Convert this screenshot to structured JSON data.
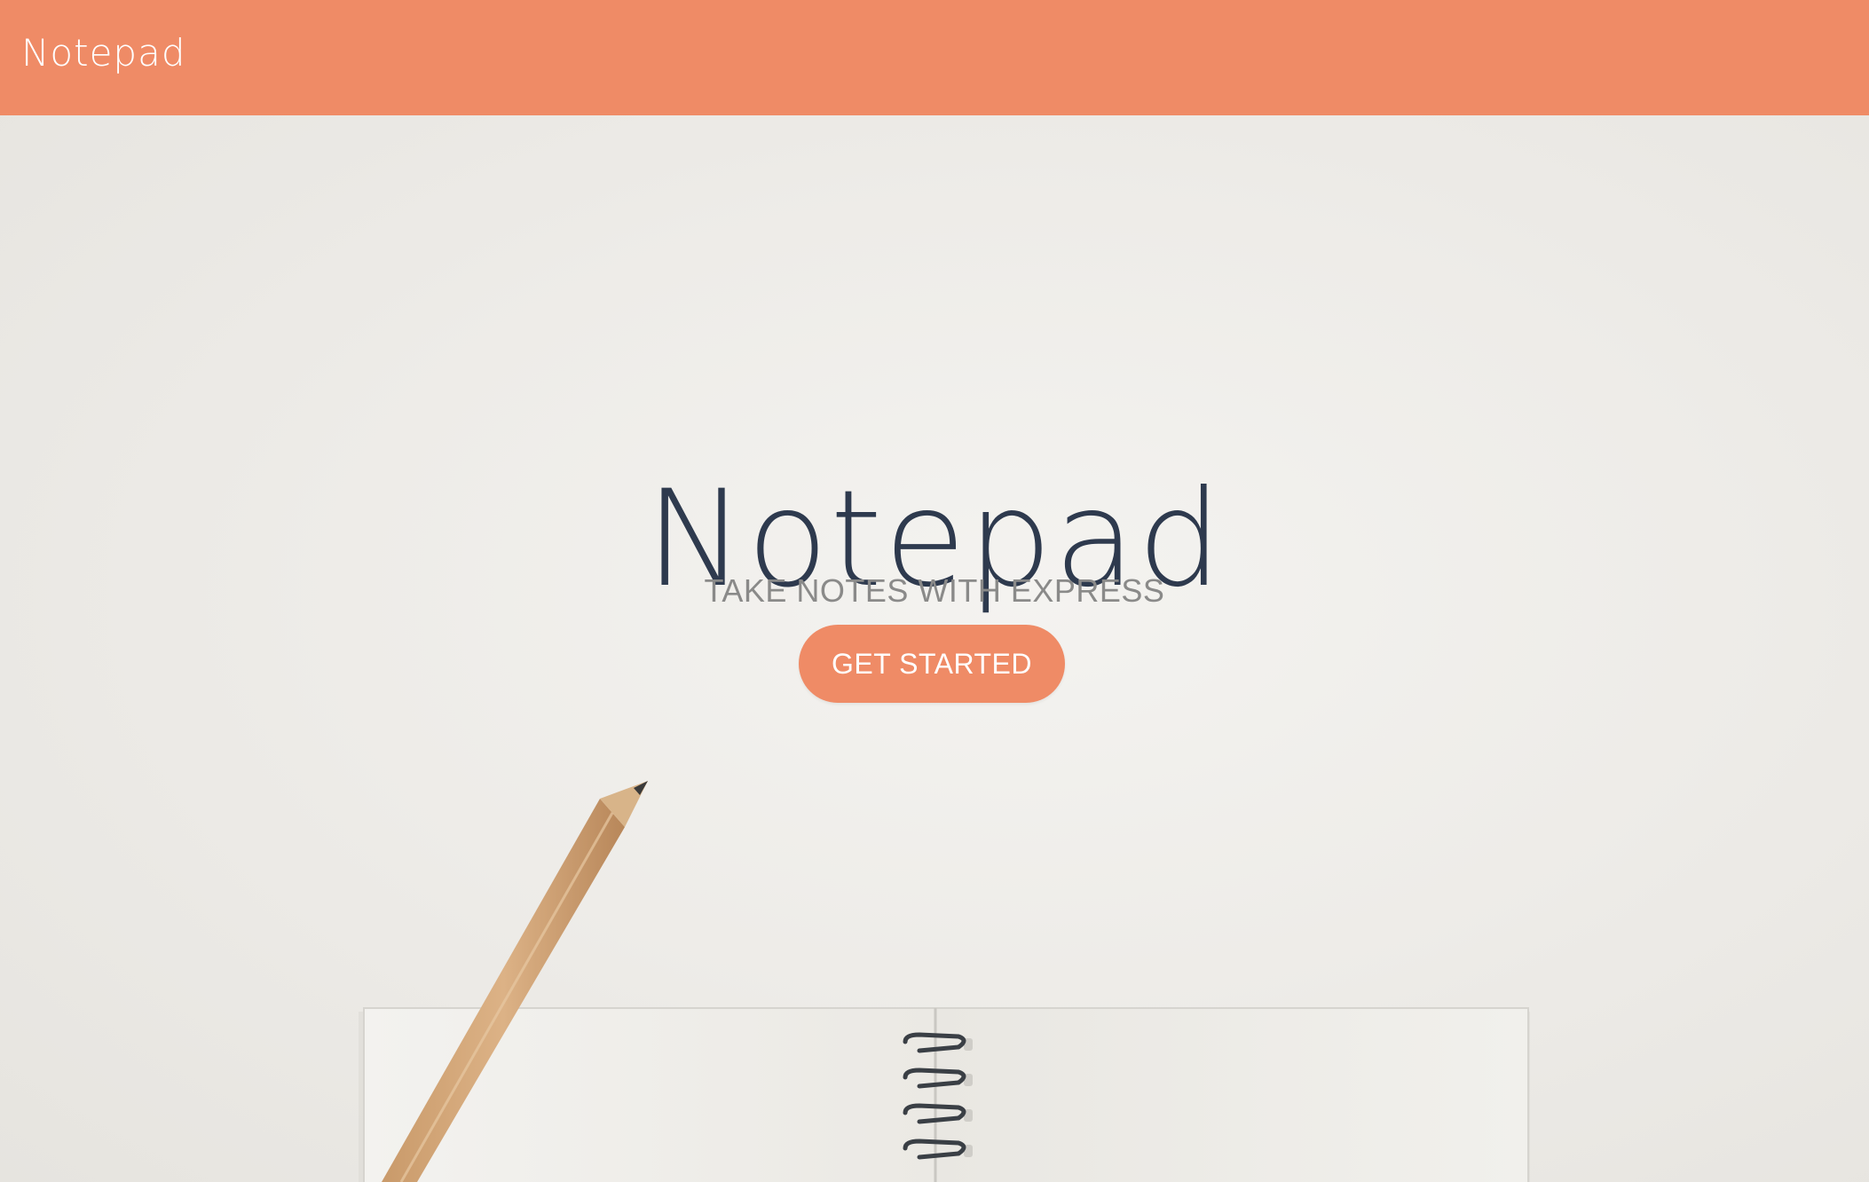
{
  "navbar": {
    "brand": "Notepad"
  },
  "hero": {
    "title": "Notepad",
    "subtitle": "TAKE NOTES WITH EXPRESS",
    "cta_label": "GET STARTED"
  },
  "colors": {
    "accent": "#ef8b66",
    "title": "#2e3a4e",
    "subtitle": "#8a8a89",
    "background": "#eceae6"
  },
  "icons": [
    "pencil-illustration",
    "notebook-illustration"
  ]
}
